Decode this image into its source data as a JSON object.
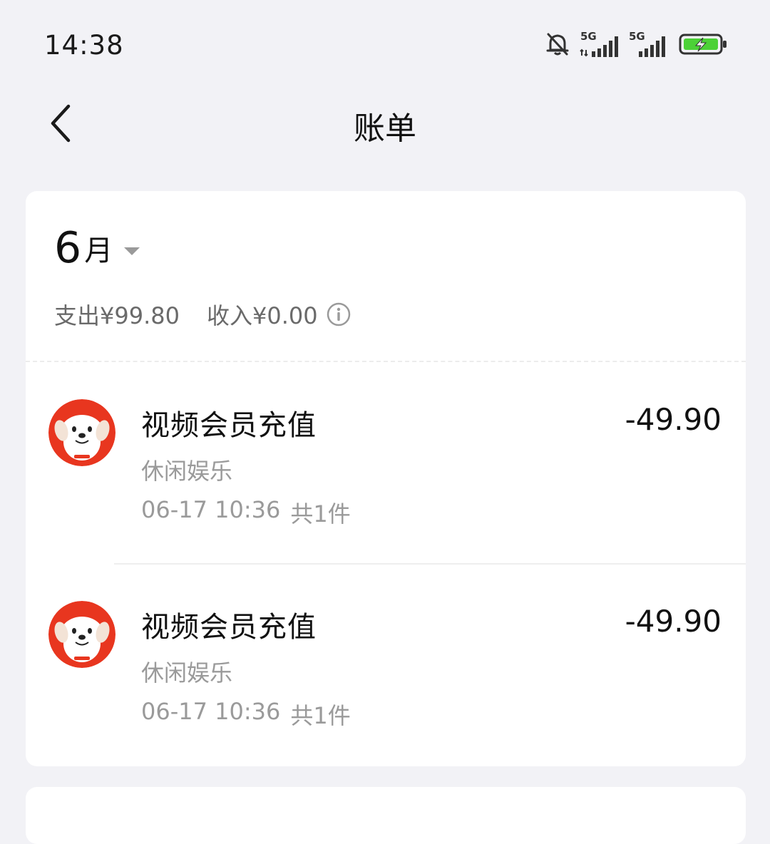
{
  "status_bar": {
    "time": "14:38",
    "signal_label_1": "5G",
    "signal_label_2": "5G",
    "icons": [
      "bell-muted-icon",
      "signal-5g-icon",
      "signal-5g-icon",
      "battery-charging-icon"
    ]
  },
  "nav": {
    "title": "账单",
    "back_icon": "chevron-left-icon"
  },
  "month": {
    "number": "6",
    "unit": "月"
  },
  "summary": {
    "expense": "支出¥99.80",
    "income": "收入¥0.00"
  },
  "items": [
    {
      "title": "视频会员充值",
      "category": "休闲娱乐",
      "date": "06-17 10:36",
      "count": "共1件",
      "amount": "-49.90"
    },
    {
      "title": "视频会员充值",
      "category": "休闲娱乐",
      "date": "06-17 10:36",
      "count": "共1件",
      "amount": "-49.90"
    }
  ],
  "colors": {
    "background": "#f2f2f6",
    "card": "#ffffff",
    "brand_red": "#e8361f",
    "muted_text": "#9a9a9a",
    "battery_green": "#4cd137"
  }
}
